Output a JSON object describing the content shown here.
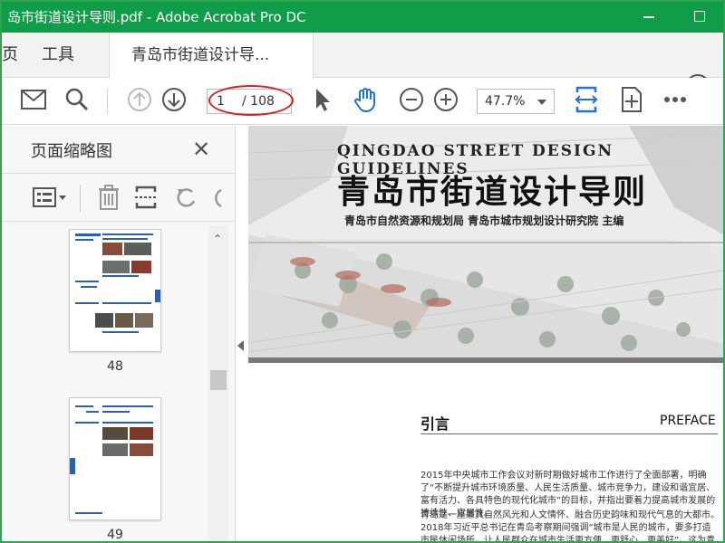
{
  "window": {
    "title": "岛市街道设计导则.pdf - Adobe Acrobat Pro DC"
  },
  "tabs": {
    "home_partial": "页",
    "tools": "工具",
    "document": "青岛市街道设计导..."
  },
  "toolbar": {
    "current_page": "1",
    "total_pages": "/ 108",
    "zoom": "47.7%"
  },
  "sidebar": {
    "title": "页面缩略图",
    "thumbnails": [
      {
        "label": "48"
      },
      {
        "label": "49"
      }
    ]
  },
  "document": {
    "title_en": "QINGDAO STREET DESIGN GUIDELINES",
    "title_cn": "青岛市街道设计导则",
    "editors": "青岛市自然资源和规划局  青岛市城市规划设计研究院  主编",
    "preface_cn": "引言",
    "preface_en": "PREFACE",
    "paragraph1": "2015年中央城市工作会议对新时期做好城市工作进行了全面部署，明确了“不断提升城市环境质量、人民生活质量、城市竞争力，建设和谐宜居、富有活力、各具特色的现代化城市”的目标，并指出要着力提高城市发展的持续性、宜居性。",
    "paragraph2": "青岛是一座兼具自然风光和人文情怀、融合历史韵味和现代气息的大都市。2018年习近平总书记在青岛考察期间强调“城市是人民的城市，要多打造市民休闲场所，让人民群众在城市生活更方便、更舒心、更美好”。这为青岛的城市发展指"
  },
  "colors": {
    "titlebar": "#0f9d4a",
    "accent_blue": "#1f73d1",
    "annotation_red": "#d81f1f"
  }
}
